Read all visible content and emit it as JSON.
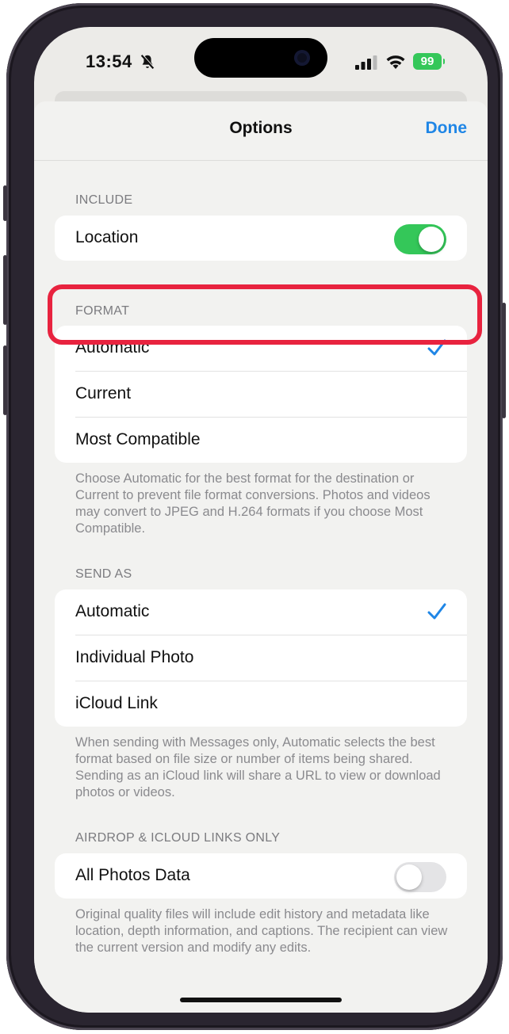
{
  "status_bar": {
    "time": "13:54",
    "battery": "99",
    "icons": [
      "bell-slash-icon",
      "cellular-signal-icon",
      "wifi-icon",
      "battery-charging-icon"
    ]
  },
  "nav": {
    "title": "Options",
    "done_label": "Done",
    "accent_color": "#1f86e6"
  },
  "include": {
    "header": "INCLUDE",
    "location_label": "Location",
    "location_on": true
  },
  "format": {
    "header": "FORMAT",
    "options": [
      {
        "label": "Automatic",
        "selected": true
      },
      {
        "label": "Current",
        "selected": false
      },
      {
        "label": "Most Compatible",
        "selected": false
      }
    ],
    "footer": "Choose Automatic for the best format for the destination or Current to prevent file format conversions. Photos and videos may convert to JPEG and H.264 formats if you choose Most Compatible."
  },
  "send_as": {
    "header": "SEND AS",
    "options": [
      {
        "label": "Automatic",
        "selected": true
      },
      {
        "label": "Individual Photo",
        "selected": false
      },
      {
        "label": "iCloud Link",
        "selected": false
      }
    ],
    "footer": "When sending with Messages only, Automatic selects the best format based on file size or number of items being shared. Sending as an iCloud link will share a URL to view or download photos or videos."
  },
  "airdrop": {
    "header": "AIRDROP & ICLOUD LINKS ONLY",
    "all_photos_label": "All Photos Data",
    "all_photos_on": false,
    "footer": "Original quality files will include edit history and metadata like location, depth information, and captions. The recipient can view the current version and modify any edits."
  },
  "colors": {
    "toggle_on": "#34c759",
    "highlight": "#e8233f"
  }
}
